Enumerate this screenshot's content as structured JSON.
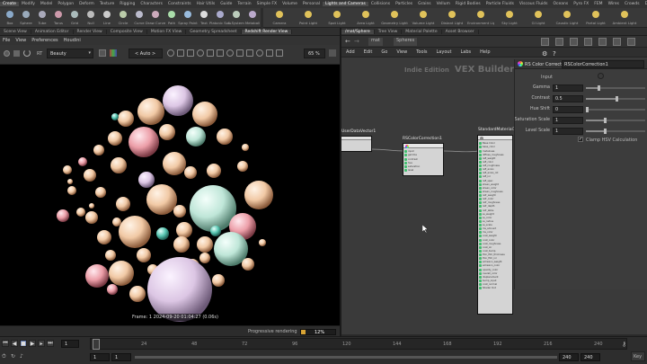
{
  "shelf": {
    "tabs": [
      "Create",
      "Modify",
      "Model",
      "Polygon",
      "Deform",
      "Texture",
      "Rigging",
      "Characters",
      "Constraints",
      "Hair Utils",
      "Guide",
      "Terrain",
      "Simple FX",
      "Volume",
      "Personal",
      "Lights and Cameras",
      "Collisions",
      "Particles",
      "Grains",
      "Vellum",
      "Rigid Bodies",
      "Particle Fluids",
      "Viscous Fluids",
      "Oceans",
      "Pyro FX",
      "FEM",
      "Wires",
      "Crowds",
      "Drive Simulation"
    ],
    "active_tab": "Create",
    "left_tools": [
      "Box",
      "Sphere",
      "Tube",
      "Torus",
      "Grid",
      "Null",
      "Line",
      "Circle",
      "Curve",
      "Draw Curve",
      "Path",
      "Spray Paint",
      "Text",
      "Platonic Solids",
      "L-System",
      "Metaball"
    ],
    "right_tab": "Lights and Cameras",
    "right_tools": [
      "Camera",
      "Point Light",
      "Spot Light",
      "Area Light",
      "Geometry Light",
      "Volume Light",
      "Distant Light",
      "Environment Light",
      "Sky Light",
      "GI Light",
      "Caustic Light",
      "Portal Light",
      "Ambient Light"
    ]
  },
  "left_pane_tabs": [
    "Scene View",
    "Animation Editor",
    "Render View",
    "Composite View",
    "Motion FX View",
    "Geometry Spreadsheet",
    "Redshift Render View"
  ],
  "left_active_tab": "Redshift Render View",
  "viewer": {
    "menu": [
      "File",
      "View",
      "Preferences",
      "Houdini"
    ],
    "aov": "Beauty",
    "aov_prefix": "RT",
    "zoom_mode": "< Auto >",
    "zoom": "65 %",
    "frame_caption": "Frame: 1  2024-09-20  01:04:27  (0.06s)",
    "progressive_label": "Progressive rendering",
    "progress_percent": 12,
    "progress_text": "12%"
  },
  "right_pane_tabs": [
    "/mat/Sphere",
    "Tree View",
    "Material Palette",
    "Asset Browser"
  ],
  "right_active_tab": "/mat/Sphere",
  "network": {
    "path": [
      "mat",
      "Spheres"
    ],
    "menu": [
      "Add",
      "Edit",
      "Go",
      "View",
      "Tools",
      "Layout",
      "Labs",
      "Help"
    ],
    "watermark_small": "Indie Edition",
    "watermark_large": "VEX Builder",
    "nodes": {
      "left_partial": "UserDataVector1",
      "color_correction": "RSColorCorrection1",
      "material": "StandardMaterial1"
    },
    "material_ports": [
      "Base Color",
      "base_color",
      "metalness",
      "diffuse_roughness",
      "refl_weight",
      "refl_color",
      "refl_roughness",
      "refl_aniso",
      "refl_aniso_rot",
      "refl_ior",
      "refl_spec",
      "sheen_weight",
      "sheen_color",
      "sheen_roughness",
      "refr_weight",
      "refr_color",
      "refr_roughness",
      "refr_depth",
      "refr_abbe",
      "ss_weight",
      "ss_color",
      "ss_radius",
      "ss_scale",
      "ms_amount",
      "ms_color",
      "coat_weight",
      "coat_color",
      "coat_roughness",
      "coat_ior",
      "coat_bump",
      "thin_film_thickness",
      "thin_film_ior",
      "emission_weight",
      "emission_color",
      "opacity_color",
      "overall_color",
      "displacement",
      "bump_input",
      "coat_normal",
      "Shader Out"
    ]
  },
  "params": {
    "node_type": "RS Color Correct",
    "node_name": "RSColorCorrection1",
    "input_label": "Input",
    "rows": [
      {
        "label": "Gamma",
        "value": "1",
        "fill": 0.2
      },
      {
        "label": "Contrast",
        "value": "0.5",
        "fill": 0.5
      },
      {
        "label": "Hue Shift",
        "value": "0",
        "fill": 0.0
      },
      {
        "label": "Saturation Scale",
        "value": "1",
        "fill": 0.3
      },
      {
        "label": "Level Scale",
        "value": "1",
        "fill": 0.3
      }
    ],
    "clamp_label": "Clamp HSV Calculation",
    "clamp_checked": true
  },
  "timeline": {
    "ticks": [
      "1",
      "24",
      "48",
      "72",
      "96",
      "120",
      "144",
      "168",
      "192",
      "216",
      "240"
    ],
    "current_frame": "1",
    "start_frame": "1",
    "start_frame2": "1",
    "end_frame": "240",
    "end_frame2": "240",
    "keys_label": "Key"
  }
}
